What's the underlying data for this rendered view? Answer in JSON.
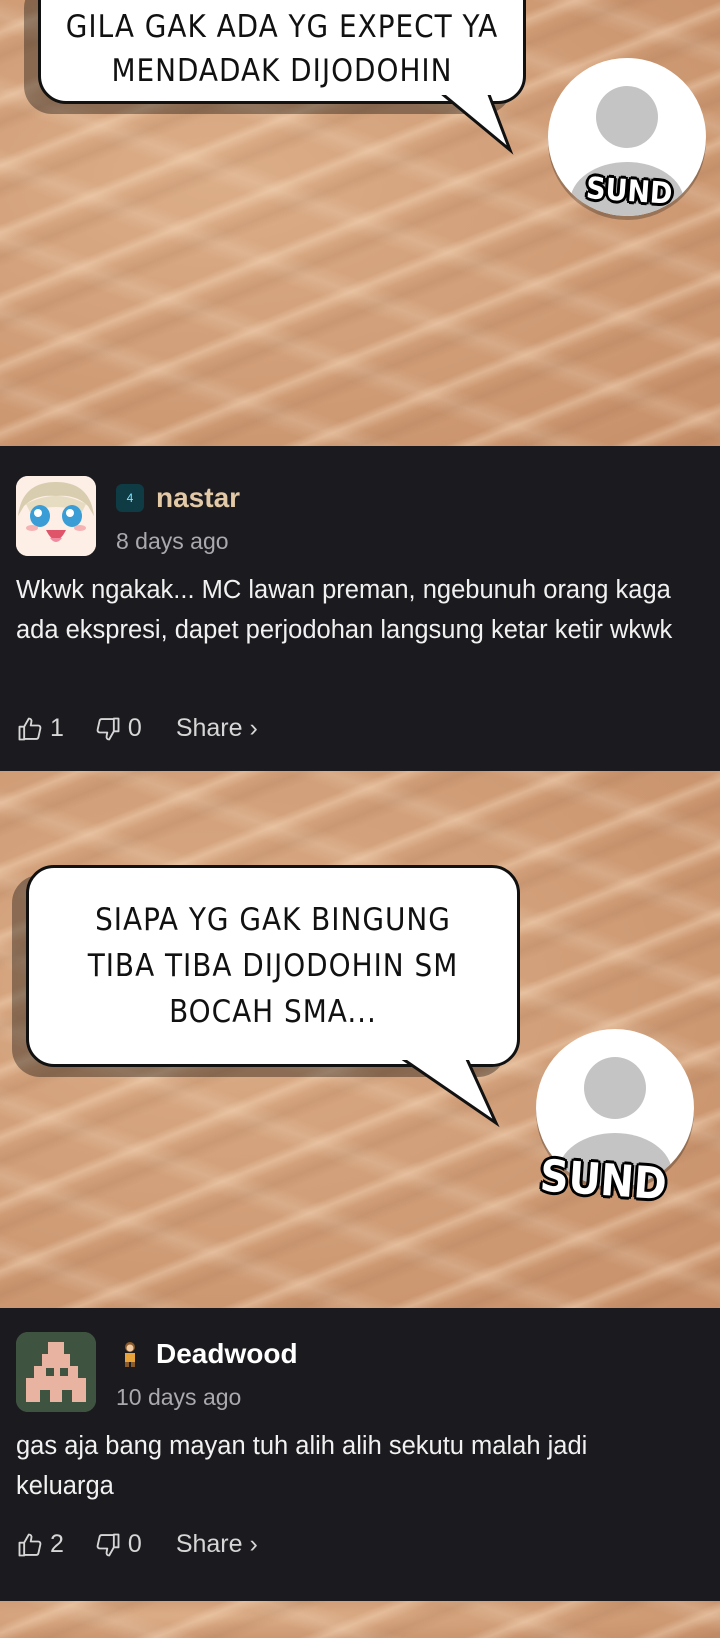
{
  "panels": [
    {
      "bubble_text": "GILA GAK ADA YG EXPECT YA\nMENDADAK DIJODOHIN",
      "name_tag": "SUND"
    },
    {
      "bubble_text": "SIAPA YG GAK BINGUNG\nTIBA TIBA DIJODOHIN SM\nBOCAH SMA...",
      "name_tag": "SUND"
    }
  ],
  "comments": [
    {
      "badge": "4",
      "username": "nastar",
      "username_color": "#e3c9a6",
      "time": "8 days ago",
      "text": "Wkwk ngakak... MC lawan preman, ngebunuh orang kaga ada ekspresi, dapet perjodohan langsung ketar ketir wkwk",
      "likes": "1",
      "dislikes": "0",
      "share_label": "Share ›"
    },
    {
      "badge": "",
      "username": "Deadwood",
      "username_color": "#ffffff",
      "time": "10 days ago",
      "text": "gas aja bang mayan tuh alih alih sekutu malah jadi keluarga",
      "likes": "2",
      "dislikes": "0",
      "share_label": "Share ›"
    }
  ]
}
